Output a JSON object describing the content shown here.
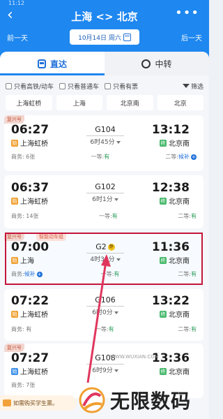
{
  "status_bar": "11:12",
  "header": {
    "route": "上海 <> 北京",
    "prev_day": "前一天",
    "next_day": "后一天",
    "date": "10月14日 周六"
  },
  "modes": [
    {
      "label": "直达",
      "icon": "train-icon",
      "active": true
    },
    {
      "label": "中转",
      "icon": "transfer-icon",
      "active": false
    }
  ],
  "filters": {
    "only_gd": "只看高铁/动车",
    "only_normal": "只看普通车",
    "only_available": "只看有票",
    "filter_label": "筛选"
  },
  "stations": [
    "上海虹桥",
    "上海",
    "北京南",
    "北京"
  ],
  "trains": [
    {
      "badge": "复兴号",
      "dep": "06:27",
      "dep_station": "上海虹桥",
      "no": "G104",
      "duration": "6时45分",
      "arr": "13:12",
      "arr_station": "北京南",
      "biz": "商务: 6张",
      "first": "一等:",
      "first_val": "有",
      "second": "二等:",
      "second_val": "候补"
    },
    {
      "badge": "",
      "dep": "06:37",
      "dep_station": "上海虹桥",
      "no": "G102",
      "duration": "6时1分",
      "arr": "12:38",
      "arr_station": "北京南",
      "biz": "商务: 14张",
      "first": "一等:",
      "first_val": "有",
      "second": "二等:",
      "second_val": "有"
    },
    {
      "badge": "复兴号",
      "badge2": "智能动车组",
      "dep": "07:00",
      "dep_station": "上海",
      "no": "G2",
      "jing": "静",
      "duration": "4时36分",
      "arr": "11:36",
      "arr_station": "北京南",
      "biz": "商务:",
      "biz_val": "候补",
      "first": "一等:",
      "first_val": "有",
      "second": "二等:",
      "second_val": "有"
    },
    {
      "badge": "",
      "dep": "07:22",
      "dep_station": "上海虹桥",
      "no": "G106",
      "duration": "6时0分",
      "arr": "13:22",
      "arr_station": "北京南",
      "biz": "商务: 有",
      "first": "一等:",
      "first_val": "有",
      "second": "二等:",
      "second_val": "有"
    },
    {
      "badge": "复兴号",
      "dep": "07:27",
      "dep_station": "上海虹桥",
      "no": "G108",
      "duration": "6时9分",
      "arr": "13:36",
      "arr_station": "北京南",
      "biz": "商务: 7张",
      "first": "一等:",
      "first_val": "有",
      "second": "二等:",
      "second_val": "有"
    }
  ],
  "student_tip": "如需购买学生票。",
  "watermark": {
    "text": "无限数码",
    "url": "WWW.WUXIAN.COM"
  },
  "colors": {
    "brand": "#1e87f0",
    "highlight": "#c4153a",
    "available": "#2a9b5a"
  }
}
